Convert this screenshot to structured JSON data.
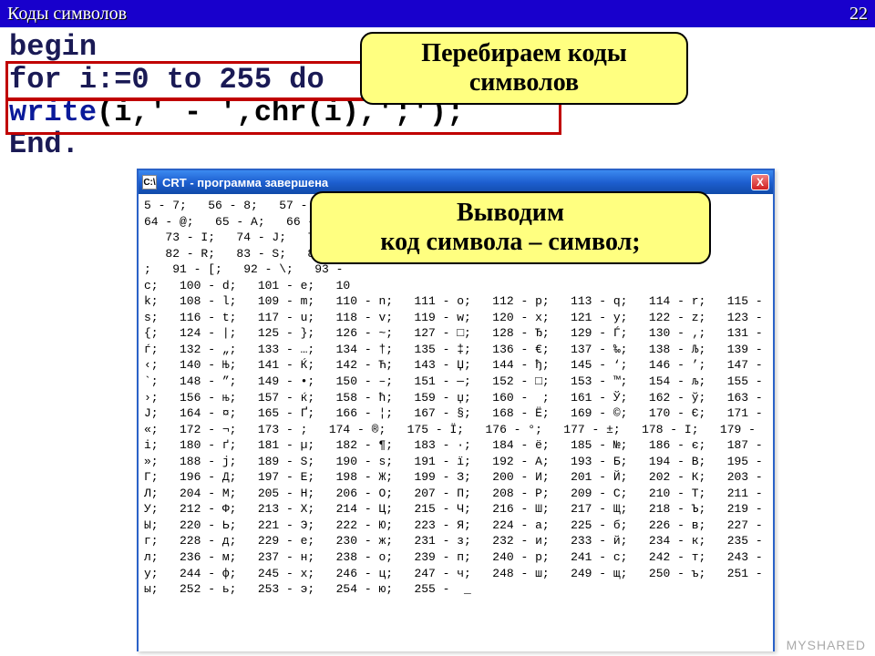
{
  "header": {
    "title": "Коды символов",
    "page": "22"
  },
  "code": {
    "l1": "begin",
    "l2": "for i:=0 to 255 do",
    "l3a": "write",
    "l3b": "(i,' - ',chr(i),';');",
    "l4": "End."
  },
  "callout1": {
    "l1": "Перебираем коды",
    "l2": "символов"
  },
  "callout2": {
    "l1": "Выводим",
    "l2": "код символа – символ;"
  },
  "window": {
    "icon": "C:\\",
    "title": "CRT - программа завершена",
    "close": "X"
  },
  "console": {
    "lines": [
      "5 - 7;   56 - 8;   57 - 9;",
      "64 - @;   65 - A;   66 - B;",
      "   73 - I;   74 - J;   75 - K",
      "   82 - R;   83 - S;   84 - ",
      ";   91 - [;   92 - \\;   93 -",
      "c;   100 - d;   101 - e;   10",
      "k;   108 - l;   109 - m;   110 - n;   111 - o;   112 - p;   113 - q;   114 - r;   115 -",
      "s;   116 - t;   117 - u;   118 - v;   119 - w;   120 - x;   121 - y;   122 - z;   123 -",
      "{;   124 - |;   125 - };   126 - ~;   127 - □;   128 - Ђ;   129 - Ѓ;   130 - ‚;   131 -",
      "ѓ;   132 - „;   133 - …;   134 - †;   135 - ‡;   136 - €;   137 - ‰;   138 - Љ;   139 -",
      "‹;   140 - Њ;   141 - Ќ;   142 - Ћ;   143 - Џ;   144 - ђ;   145 - ‘;   146 - ’;   147 -",
      "`;   148 - ”;   149 - •;   150 - –;   151 - —;   152 - □;   153 - ™;   154 - љ;   155 -",
      "›;   156 - њ;   157 - ќ;   158 - ћ;   159 - џ;   160 -  ;   161 - Ў;   162 - ў;   163 -",
      "Ј;   164 - ¤;   165 - Ґ;   166 - ¦;   167 - §;   168 - Ё;   169 - ©;   170 - Є;   171 -",
      "«;   172 - ¬;   173 - ­;   174 - ®;   175 - Ї;   176 - °;   177 - ±;   178 - І;   179 -",
      "і;   180 - ґ;   181 - µ;   182 - ¶;   183 - ·;   184 - ё;   185 - №;   186 - є;   187 -",
      "»;   188 - ј;   189 - Ѕ;   190 - ѕ;   191 - ї;   192 - А;   193 - Б;   194 - В;   195 -",
      "Г;   196 - Д;   197 - Е;   198 - Ж;   199 - З;   200 - И;   201 - Й;   202 - К;   203 -",
      "Л;   204 - М;   205 - Н;   206 - О;   207 - П;   208 - Р;   209 - С;   210 - Т;   211 -",
      "У;   212 - Ф;   213 - Х;   214 - Ц;   215 - Ч;   216 - Ш;   217 - Щ;   218 - Ъ;   219 -",
      "Ы;   220 - Ь;   221 - Э;   222 - Ю;   223 - Я;   224 - а;   225 - б;   226 - в;   227 -",
      "г;   228 - д;   229 - е;   230 - ж;   231 - з;   232 - и;   233 - й;   234 - к;   235 -",
      "л;   236 - м;   237 - н;   238 - о;   239 - п;   240 - р;   241 - с;   242 - т;   243 -",
      "у;   244 - ф;   245 - х;   246 - ц;   247 - ч;   248 - ш;   249 - щ;   250 - ъ;   251 -",
      "ы;   252 - ь;   253 - э;   254 - ю;   255 -  _"
    ]
  },
  "watermark": "MYSHARED"
}
